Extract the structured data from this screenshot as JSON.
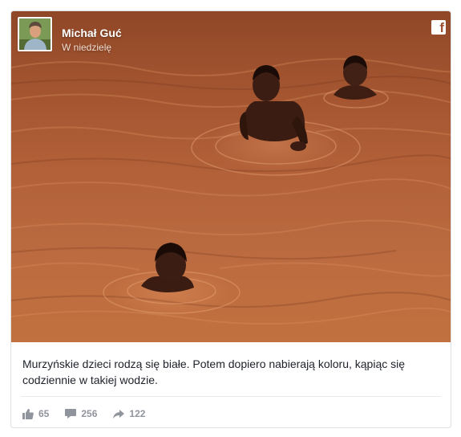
{
  "post": {
    "author": "Michał Guć",
    "time": "W niedzielę",
    "caption": "Murzyńskie dzieci rodzą się białe. Potem dopiero nabierają koloru, kąpiąc się codziennie w takiej wodzie."
  },
  "stats": {
    "likes": "65",
    "comments": "256",
    "shares": "122"
  },
  "icons": {
    "platform": "facebook-icon",
    "likes": "thumbs-up-icon",
    "comments": "comment-icon",
    "shares": "share-arrow-icon"
  },
  "colors": {
    "water": "#b05f37",
    "meta_text": "#90949c",
    "caption_text": "#1d2129"
  }
}
